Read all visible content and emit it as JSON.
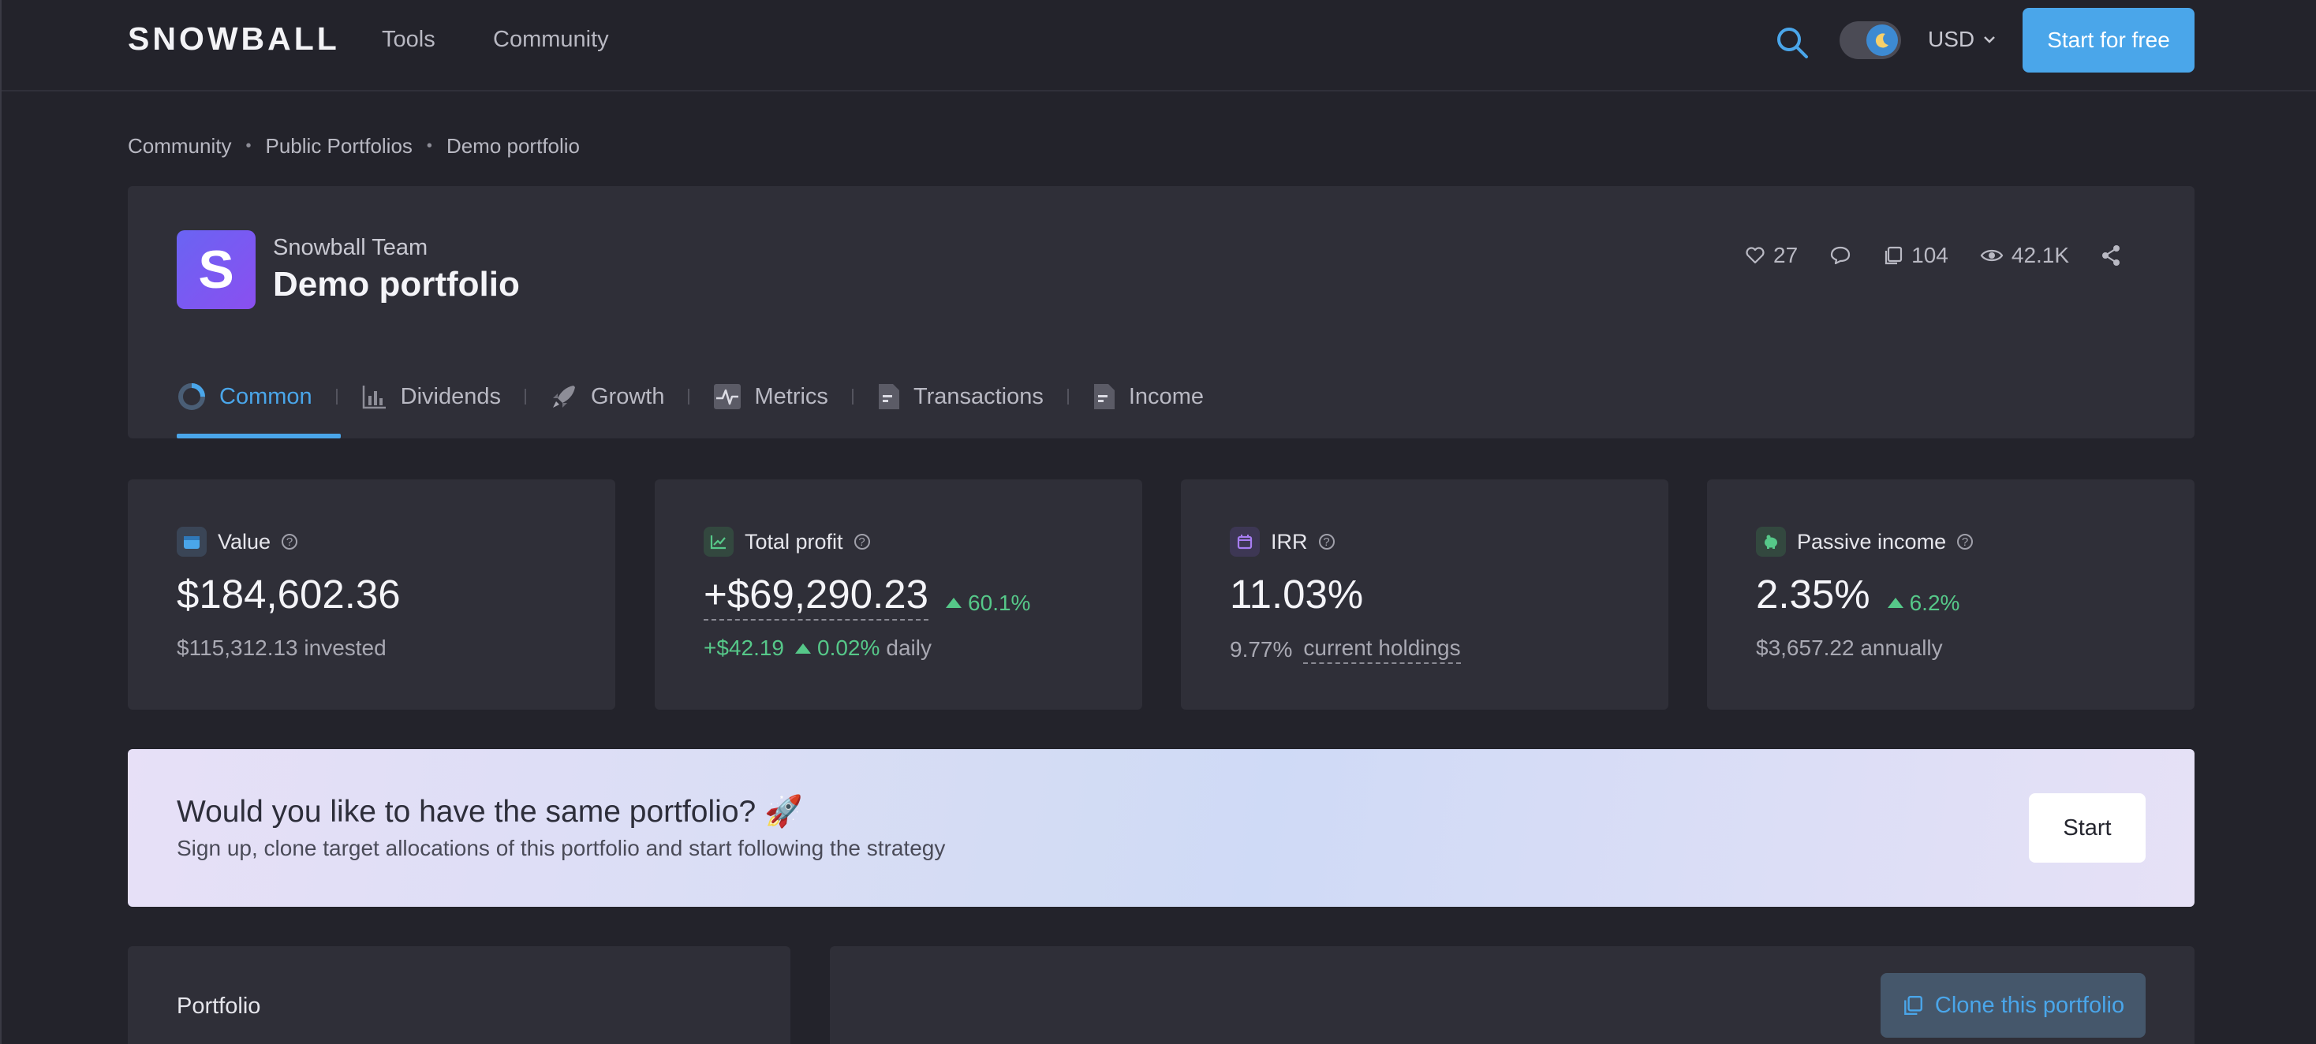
{
  "header": {
    "logo": "SNOWBALL",
    "nav": [
      "Tools",
      "Community"
    ],
    "currency": "USD",
    "cta_label": "Start for free"
  },
  "breadcrumb": [
    "Community",
    "Public Portfolios",
    "Demo portfolio"
  ],
  "portfolio": {
    "avatar_letter": "S",
    "owner": "Snowball Team",
    "title": "Demo portfolio",
    "likes": "27",
    "copies": "104",
    "views": "42.1K"
  },
  "tabs": [
    {
      "label": "Common",
      "icon": "donut-icon"
    },
    {
      "label": "Dividends",
      "icon": "bar-chart-icon"
    },
    {
      "label": "Growth",
      "icon": "rocket-icon"
    },
    {
      "label": "Metrics",
      "icon": "pulse-icon"
    },
    {
      "label": "Transactions",
      "icon": "document-icon"
    },
    {
      "label": "Income",
      "icon": "document-icon"
    }
  ],
  "cards": {
    "value": {
      "label": "Value",
      "amount": "$184,602.36",
      "sub": "$115,312.13 invested"
    },
    "profit": {
      "label": "Total profit",
      "amount": "+$69,290.23",
      "pct": "60.1%",
      "daily_amount": "+$42.19",
      "daily_pct": "0.02%",
      "daily_label": "daily"
    },
    "irr": {
      "label": "IRR",
      "amount": "11.03%",
      "sub_value": "9.77%",
      "sub_label": "current holdings"
    },
    "income": {
      "label": "Passive income",
      "amount": "2.35%",
      "pct": "6.2%",
      "sub": "$3,657.22 annually"
    }
  },
  "promo": {
    "title": "Would you like to have the same portfolio? 🚀",
    "subtitle": "Sign up, clone target allocations of this portfolio and start following the strategy",
    "button": "Start"
  },
  "bottom": {
    "portfolio_title": "Portfolio",
    "clone_label": "Clone this portfolio"
  },
  "colors": {
    "accent": "#4aa6ea",
    "positive": "#56c889",
    "background": "#23232b",
    "card": "#2f2f38"
  }
}
